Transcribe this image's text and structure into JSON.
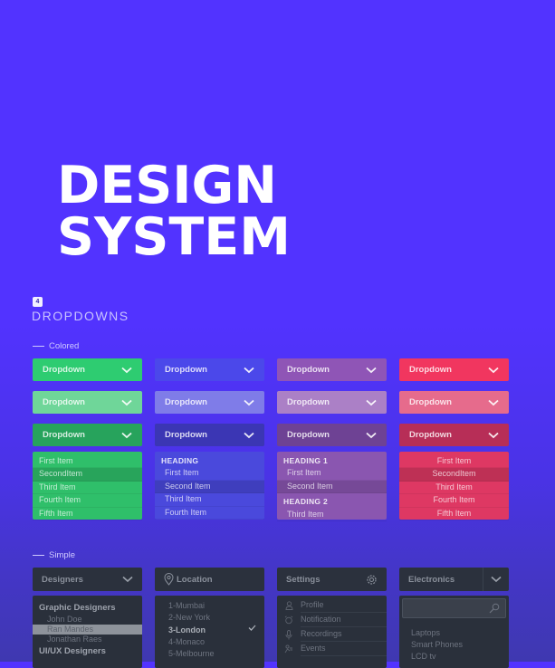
{
  "hero": {
    "line1": "DESIGN",
    "line2": "SYSTEM"
  },
  "section": {
    "badge": "4",
    "title": "DROPDOWNS"
  },
  "colored": {
    "label": "Colored",
    "columns": [
      {
        "name": "green",
        "colors": {
          "default": "#2ecc71",
          "light": "#6fd699",
          "dark": "#27a35c",
          "list": "#2fbf6a"
        },
        "rows": [
          "Dropdown",
          "Dropdown",
          "Dropdown"
        ],
        "list": [
          {
            "label": "First Item"
          },
          {
            "label": "SecondItem",
            "selected": true
          },
          {
            "label": "Third Item"
          },
          {
            "label": "Fourth Item"
          },
          {
            "label": "Fifth Item"
          }
        ]
      },
      {
        "name": "blue",
        "colors": {
          "default": "#4b48ea",
          "light": "#7f7ce8",
          "dark": "#3b36b4",
          "list": "#4a49dc"
        },
        "rows": [
          "Dropdown",
          "Dropdown",
          "Dropdown"
        ],
        "list": [
          {
            "label": "HEADING",
            "heading": true
          },
          {
            "label": "First Item"
          },
          {
            "label": "Second Item",
            "selected": true
          },
          {
            "label": "Third Item"
          },
          {
            "label": "Fourth Item"
          }
        ]
      },
      {
        "name": "purple",
        "colors": {
          "default": "#8f55b6",
          "light": "#ab80c6",
          "dark": "#6e4294",
          "list": "#8a56b0"
        },
        "rows": [
          "Dropdown",
          "Dropdown",
          "Dropdown"
        ],
        "list": [
          {
            "label": "HEADING 1",
            "heading": true
          },
          {
            "label": "First Item"
          },
          {
            "label": "Second Item",
            "selected": true
          },
          {
            "label": "HEADING 2",
            "heading": true
          },
          {
            "label": "Third Item"
          }
        ]
      },
      {
        "name": "red",
        "colors": {
          "default": "#f1365f",
          "light": "#e66b8c",
          "dark": "#b72e57",
          "list": "#de3863"
        },
        "rows": [
          "Dropdown",
          "Dropdown",
          "Dropdown"
        ],
        "list": [
          {
            "label": "First Item"
          },
          {
            "label": "SecondItem",
            "selected": true
          },
          {
            "label": "Third Item"
          },
          {
            "label": "Fourth Item"
          },
          {
            "label": "Fifth Item"
          }
        ],
        "centered": true
      }
    ]
  },
  "simple": {
    "label": "Simple",
    "designers": {
      "title": "Designers",
      "groups": [
        {
          "heading": "Graphic Designers",
          "items": [
            {
              "label": "John Doe"
            },
            {
              "label": "Ran Mandes",
              "selected": true
            },
            {
              "label": "Jonathan Raes"
            }
          ]
        },
        {
          "heading": "UI/UX Designers",
          "items": []
        }
      ]
    },
    "location": {
      "title": "Location",
      "items": [
        {
          "label": "1-Mumbai"
        },
        {
          "label": "2-New York"
        },
        {
          "label": "3-London",
          "selected": true
        },
        {
          "label": "4-Monaco"
        },
        {
          "label": "5-Melbourne"
        }
      ]
    },
    "settings": {
      "title": "Settings",
      "items": [
        {
          "label": "Profile",
          "icon": "person-icon"
        },
        {
          "label": "Notification",
          "icon": "alarm-icon"
        },
        {
          "label": "Recordings",
          "icon": "microphone-icon"
        },
        {
          "label": "Events",
          "icon": "events-icon"
        }
      ]
    },
    "electronics": {
      "title": "Electronics",
      "search_placeholder": "",
      "items": [
        {
          "label": "Laptops"
        },
        {
          "label": "Smart Phones"
        },
        {
          "label": "LCD tv"
        }
      ]
    }
  }
}
